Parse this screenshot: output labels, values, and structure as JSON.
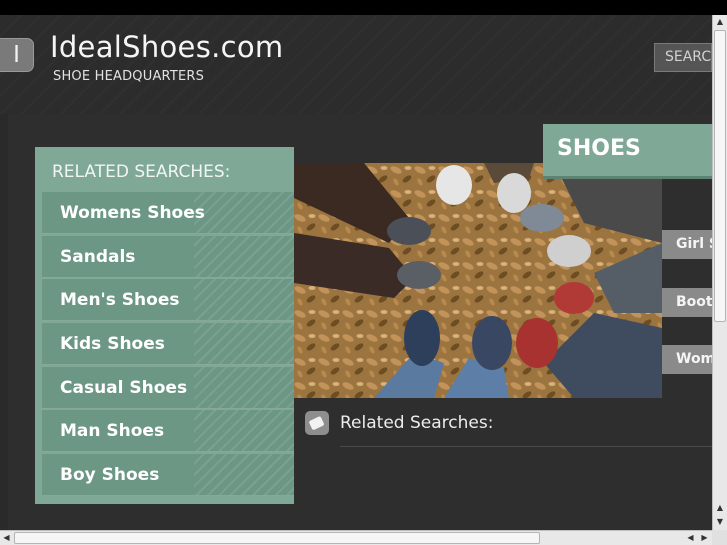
{
  "header": {
    "logo_letter": "I",
    "site_title": "IdealShoes.com",
    "tagline": "SHOE HEADQUARTERS",
    "search_button": "SEARCH"
  },
  "sidebar": {
    "heading": "RELATED SEARCHES:",
    "items": [
      {
        "label": "Womens Shoes"
      },
      {
        "label": "Sandals"
      },
      {
        "label": "Men's Shoes"
      },
      {
        "label": "Kids Shoes"
      },
      {
        "label": "Casual Shoes"
      },
      {
        "label": "Man Shoes"
      },
      {
        "label": "Boy Shoes"
      }
    ]
  },
  "category_tab": {
    "label": "SHOES",
    "side_links": [
      {
        "label": "Girl Shoes"
      },
      {
        "label": "Boots"
      },
      {
        "label": "Womens Shoes"
      }
    ]
  },
  "bottom_section": {
    "title": "Related Searches:"
  },
  "colors": {
    "accent_green": "#7fa897",
    "item_green": "#6c9784",
    "background": "#2a2a2a",
    "side_link_gray": "#8a8a8a"
  },
  "icons": {
    "logo": "logo-badge-icon",
    "related": "tag-icon"
  }
}
